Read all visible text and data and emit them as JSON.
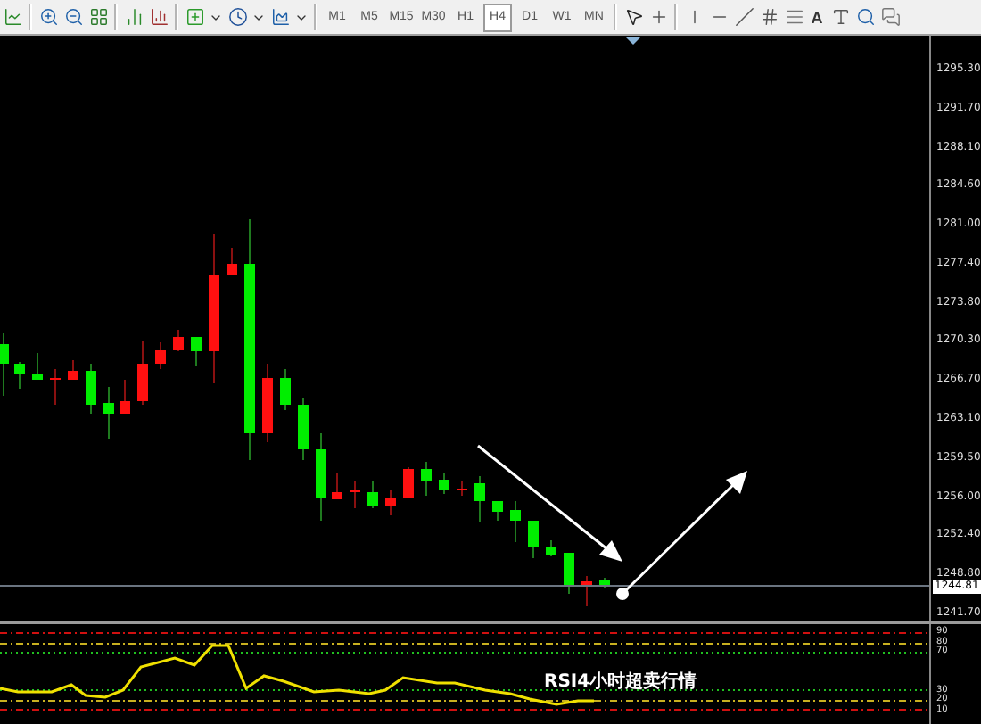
{
  "toolbar": {
    "timeframes": [
      {
        "label": "M1",
        "selected": false
      },
      {
        "label": "M5",
        "selected": false
      },
      {
        "label": "M15",
        "selected": false
      },
      {
        "label": "M30",
        "selected": false
      },
      {
        "label": "H1",
        "selected": false
      },
      {
        "label": "H4",
        "selected": true
      },
      {
        "label": "D1",
        "selected": false
      },
      {
        "label": "W1",
        "selected": false
      },
      {
        "label": "MN",
        "selected": false
      }
    ],
    "text_tool": "A"
  },
  "price_axis": {
    "labels": [
      "1295.30",
      "1291.70",
      "1288.10",
      "1284.60",
      "1281.00",
      "1277.40",
      "1273.80",
      "1270.30",
      "1266.70",
      "1263.10",
      "1259.50",
      "1256.00",
      "1252.40",
      "1248.80",
      "1241.70"
    ],
    "current_price": "1244.81"
  },
  "rsi_pane": {
    "annotation": "RSI4小时超卖行情",
    "upper_labels": [
      "90",
      "80",
      "70"
    ],
    "lower_labels": [
      "30",
      "20",
      "10"
    ]
  }
}
